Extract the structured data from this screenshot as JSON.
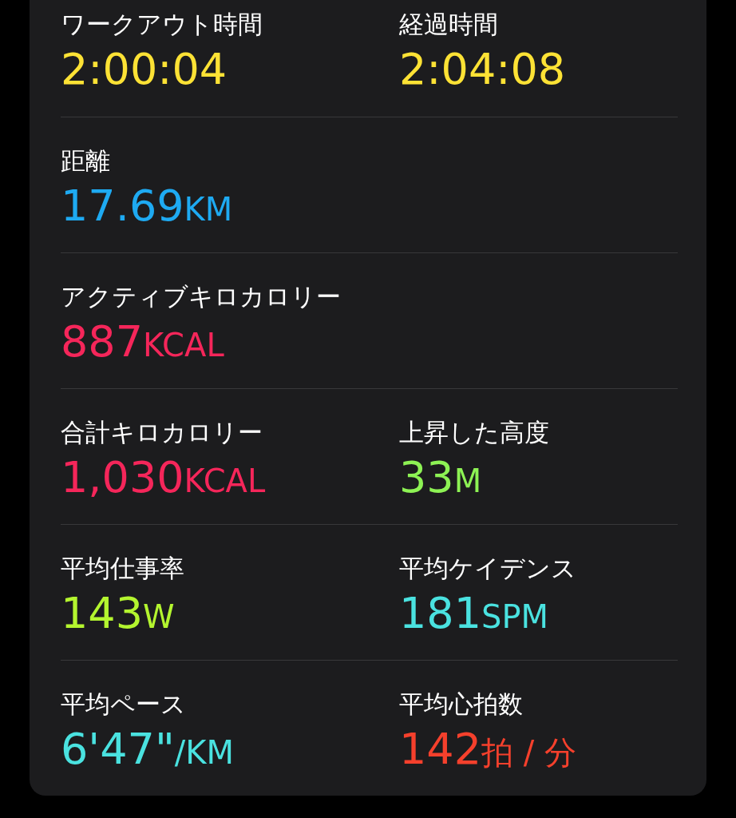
{
  "rows": [
    {
      "metrics": [
        {
          "label": "ワークアウト時間",
          "value": "2:00:04",
          "color": "#fde235"
        },
        {
          "label": "経過時間",
          "value": "2:04:08",
          "color": "#fde235"
        }
      ]
    },
    {
      "metrics": [
        {
          "label": "距離",
          "value": "17.69",
          "unit": "KM",
          "color": "#1eaaf2"
        }
      ]
    },
    {
      "metrics": [
        {
          "label": "アクティブキロカロリー",
          "value": "887",
          "unit": "KCAL",
          "color": "#f5265a"
        }
      ]
    },
    {
      "metrics": [
        {
          "label": "合計キロカロリー",
          "value": "1,030",
          "unit": "KCAL",
          "color": "#f5265a"
        },
        {
          "label": "上昇した高度",
          "value": "33",
          "unit": "M",
          "color": "#8df254"
        }
      ]
    },
    {
      "metrics": [
        {
          "label": "平均仕事率",
          "value": "143",
          "unit": "W",
          "color": "#b4f52f"
        },
        {
          "label": "平均ケイデンス",
          "value": "181",
          "unit": "SPM",
          "color": "#4ae2e0"
        }
      ]
    },
    {
      "metrics": [
        {
          "label": "平均ペース",
          "value": "6'47\"",
          "unit": "/KM",
          "color": "#4ae2e0"
        },
        {
          "label": "平均心拍数",
          "value": "142",
          "unit": "拍 / 分",
          "color": "#f5402c"
        }
      ]
    }
  ]
}
